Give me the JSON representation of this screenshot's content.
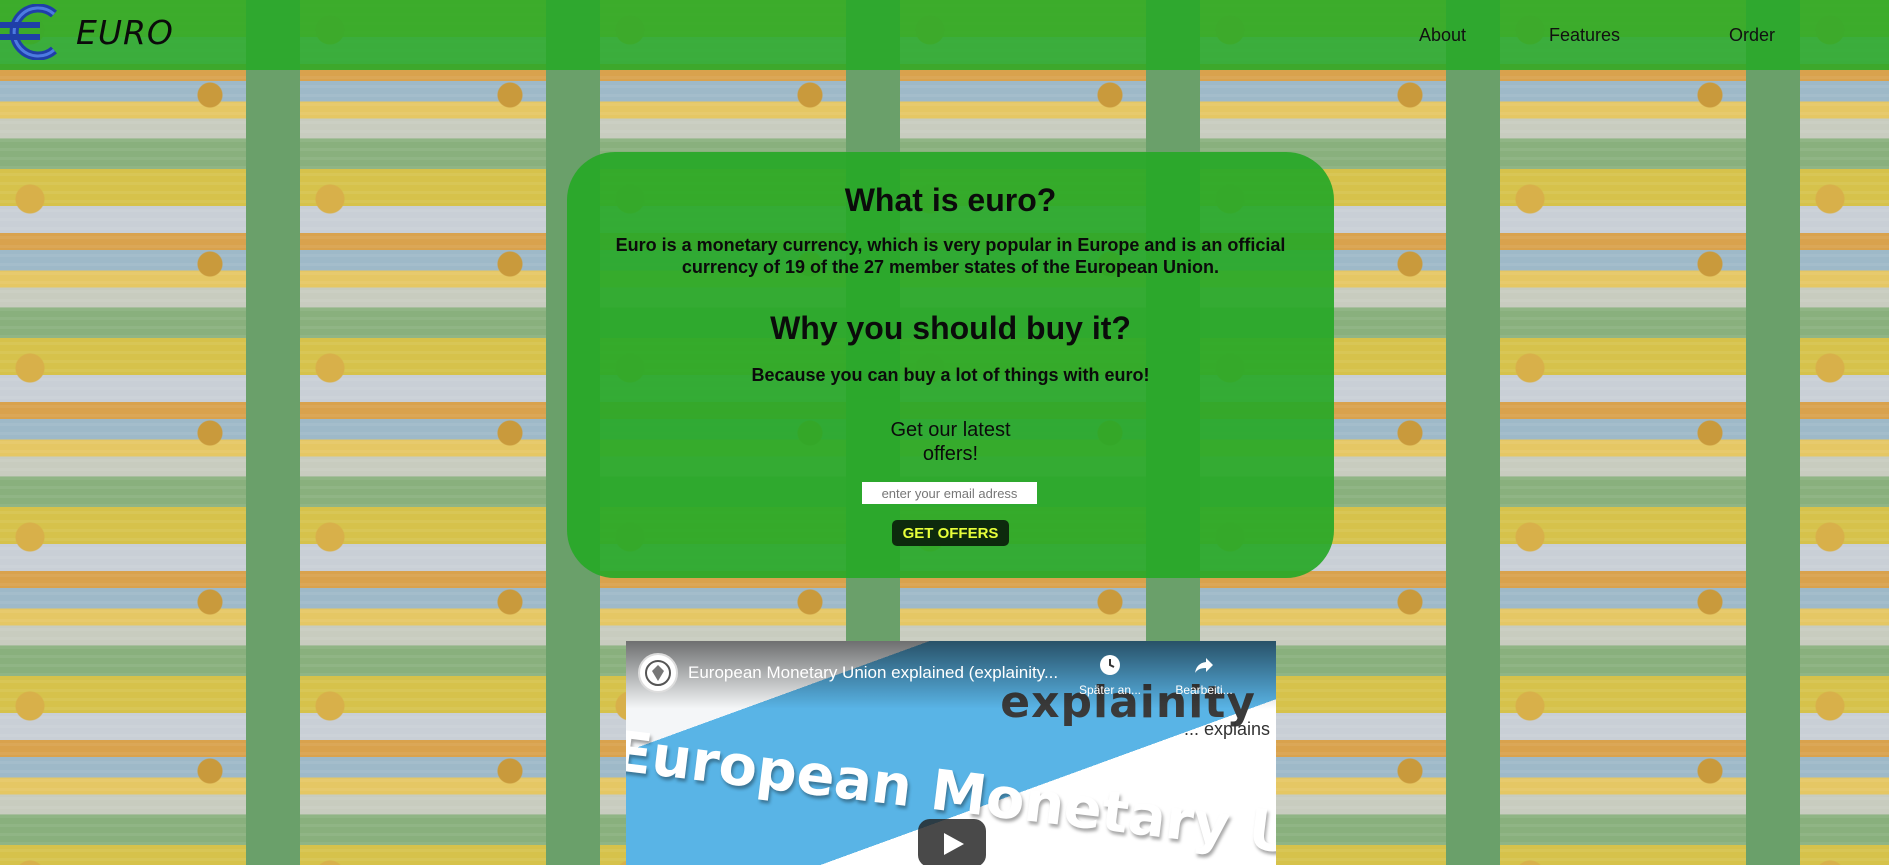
{
  "header": {
    "logo_text": "EURO",
    "logo_icon": "euro-symbol-icon",
    "nav": [
      {
        "label": "About"
      },
      {
        "label": "Features"
      },
      {
        "label": "Order"
      }
    ],
    "background_color": "#27a827"
  },
  "card": {
    "title": "What is euro?",
    "description": "Euro is a monetary currency, which is very popular in Europe and is an official currency of 19 of the 27 member states of the European Union.",
    "subtitle": "Why you should buy it?",
    "reason": "Because you can buy a lot of things with euro!",
    "offers_title": "Get our latest offers!",
    "email_placeholder": "enter your email adress",
    "button_label": "GET OFFERS",
    "button_text_color": "#e6ff3a"
  },
  "video": {
    "title": "European Monetary Union explained (explainity...",
    "actions": [
      {
        "label": "Später an...",
        "icon": "clock-icon"
      },
      {
        "label": "Bearbeiti...",
        "icon": "share-icon"
      }
    ],
    "brand": "explainity",
    "brand_sub": "... explains",
    "banner": "European Monetary Union",
    "play_icon": "play-icon"
  }
}
